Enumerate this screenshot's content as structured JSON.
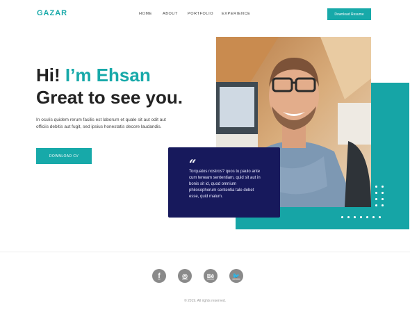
{
  "header": {
    "logo": "GAZAR",
    "nav": [
      "HOME",
      "ABOUT",
      "PORTFOLIO",
      "EXPERIENCE"
    ],
    "resume_button": "Download Resume"
  },
  "hero": {
    "greeting_prefix": "Hi! ",
    "name": "I’m Ehsan",
    "subtitle": "Great to see you.",
    "description": "In oculis quidem rerum facilis est laborum et quale sit aut odit aut officiis debitis aut fugit, sed ipsius honestatis decore laudandis.",
    "cv_button": "DOWNLOAD CV"
  },
  "quote": {
    "mark": "“",
    "text": "Torquatos nostros? quos tu paulo ante cum teneam sententiam, quid sit aut in bonis sit id, quod omnium philosophorum sententia tale debet esse, quid malum."
  },
  "footer": {
    "social": [
      {
        "icon": "facebook-icon",
        "glyph": "f"
      },
      {
        "icon": "dribbble-icon",
        "glyph": "◎"
      },
      {
        "icon": "behance-icon",
        "glyph": "Bē"
      },
      {
        "icon": "twitter-icon",
        "glyph": "🐦"
      }
    ],
    "copyright": "© 2019. All rights reserved."
  },
  "colors": {
    "accent": "#17a9a9",
    "quote_bg": "#17195c"
  }
}
